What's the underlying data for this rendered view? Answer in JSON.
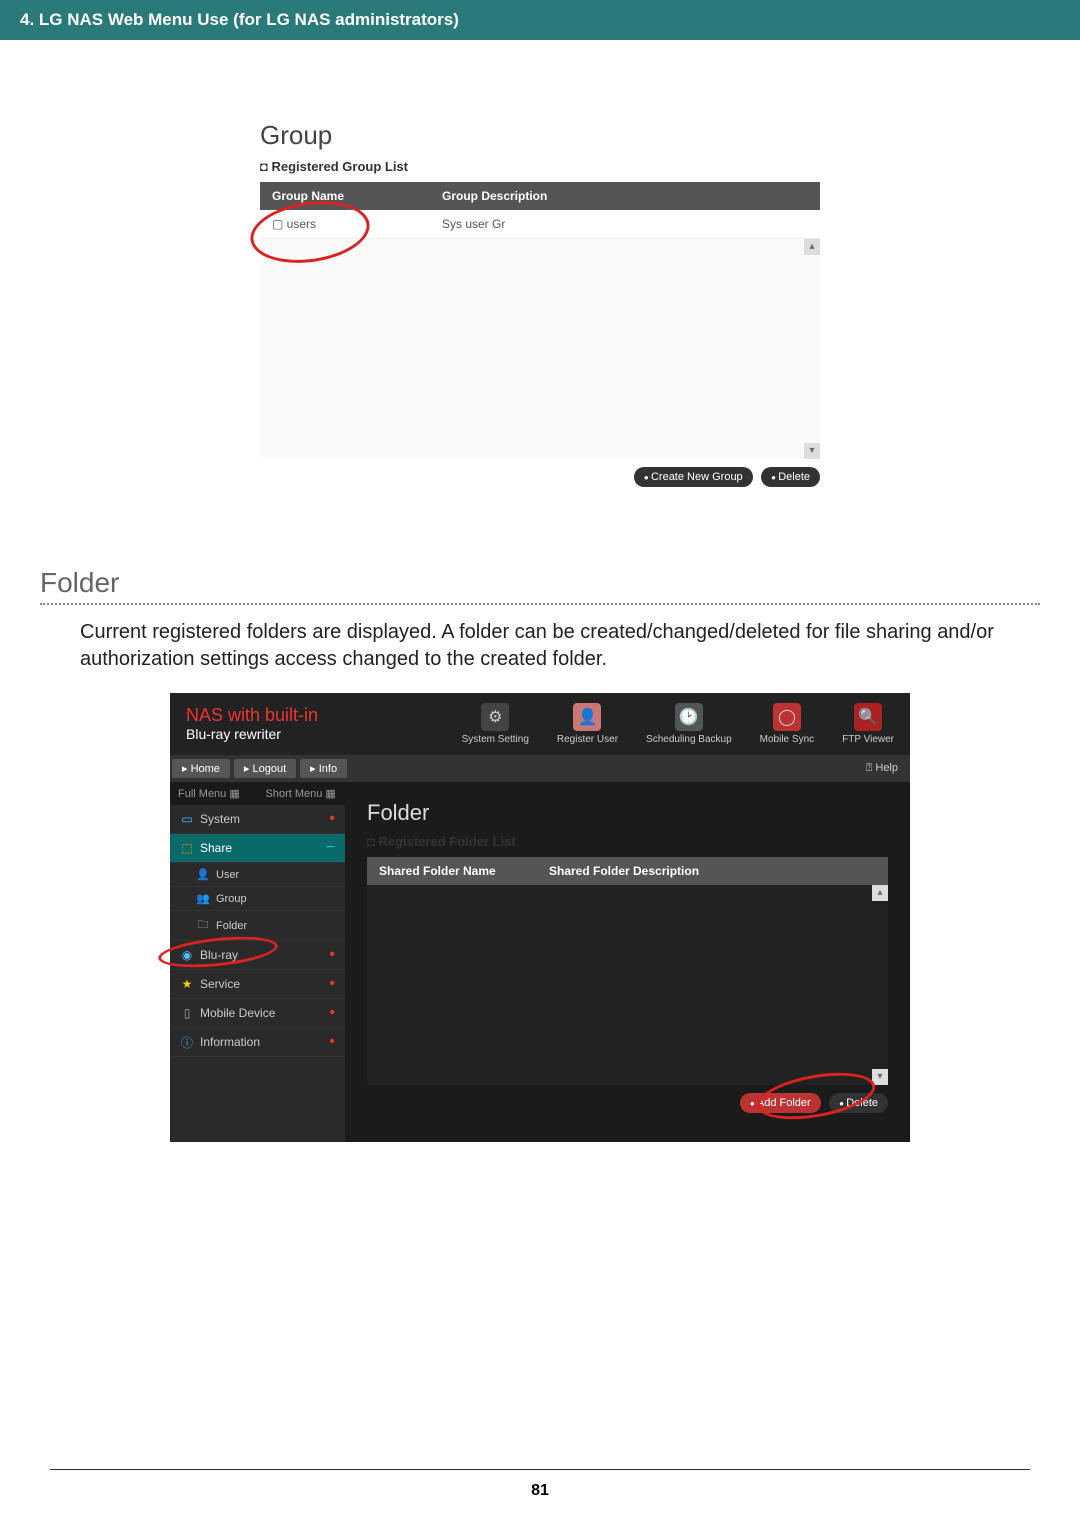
{
  "header": {
    "title": "4. LG NAS Web Menu Use (for LG NAS administrators)"
  },
  "fig1": {
    "title": "Group",
    "subhead": "Registered Group List",
    "col1": "Group Name",
    "col2": "Group Description",
    "row": {
      "name": "users",
      "desc": "Sys user Gr"
    },
    "btn_create": "Create New Group",
    "btn_delete": "Delete"
  },
  "section": {
    "heading": "Folder",
    "body": "Current registered folders are displayed. A folder can be created/changed/deleted for file sharing and/or authorization settings access changed to the created folder."
  },
  "fig2": {
    "brand_line1": "NAS with built-in",
    "brand_line2": "Blu-ray rewriter",
    "topnav": {
      "0": {
        "label": "System Setting"
      },
      "1": {
        "label": "Register User"
      },
      "2": {
        "label": "Scheduling Backup"
      },
      "3": {
        "label": "Mobile Sync"
      },
      "4": {
        "label": "FTP Viewer"
      }
    },
    "nav": {
      "home": "Home",
      "logout": "Logout",
      "info": "Info",
      "help": "Help"
    },
    "sidebar": {
      "full": "Full Menu ▦",
      "short": "Short Menu ▦",
      "system": "System",
      "share": "Share",
      "user": "User",
      "group": "Group",
      "folder": "Folder",
      "bluray": "Blu-ray",
      "service": "Service",
      "mobile": "Mobile Device",
      "info": "Information"
    },
    "main": {
      "title": "Folder",
      "subhead": "Registered Folder List",
      "col1": "Shared Folder Name",
      "col2": "Shared Folder Description",
      "btn_add": "Add Folder",
      "btn_delete": "Delete"
    }
  },
  "page_number": "81"
}
